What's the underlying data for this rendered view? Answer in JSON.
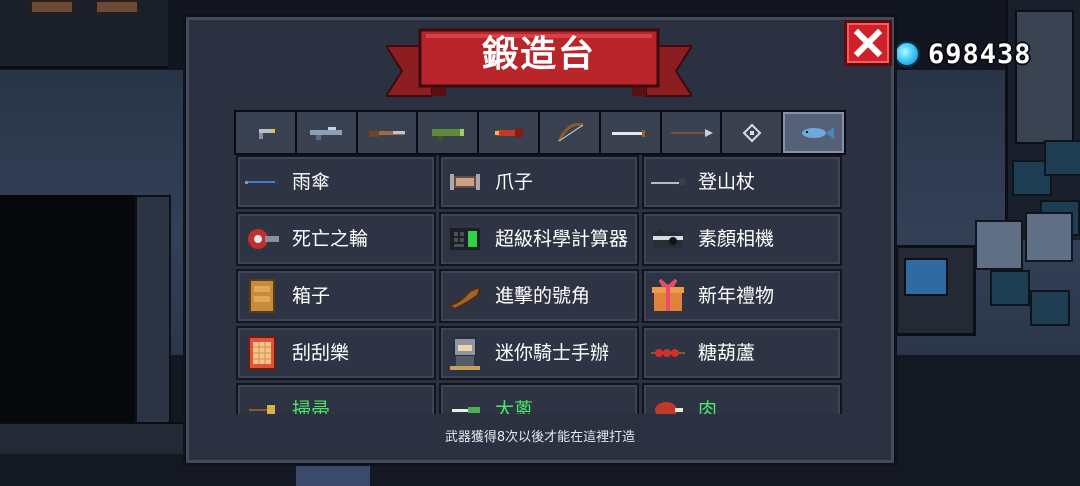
{
  "title": "鍛造台",
  "coins": "698438",
  "footer_hint": "武器獲得8次以後才能在這裡打造",
  "tabs": [
    {
      "icon": "pistol-icon"
    },
    {
      "icon": "rifle-icon"
    },
    {
      "icon": "shotgun-icon"
    },
    {
      "icon": "launcher-icon"
    },
    {
      "icon": "rocket-icon"
    },
    {
      "icon": "bow-icon"
    },
    {
      "icon": "sword-icon"
    },
    {
      "icon": "spear-icon"
    },
    {
      "icon": "staff-icon"
    },
    {
      "icon": "fish-icon"
    }
  ],
  "items": [
    {
      "label": "雨傘",
      "icon": "umbrella-icon",
      "color": "white"
    },
    {
      "label": "爪子",
      "icon": "claw-icon",
      "color": "white"
    },
    {
      "label": "登山杖",
      "icon": "hiking-pole-icon",
      "color": "white"
    },
    {
      "label": "死亡之輪",
      "icon": "death-wheel-icon",
      "color": "white"
    },
    {
      "label": "超級科學計算器",
      "icon": "calculator-icon",
      "color": "white"
    },
    {
      "label": "素顏相機",
      "icon": "camera-icon",
      "color": "white"
    },
    {
      "label": "箱子",
      "icon": "box-icon",
      "color": "white"
    },
    {
      "label": "進擊的號角",
      "icon": "horn-icon",
      "color": "white"
    },
    {
      "label": "新年禮物",
      "icon": "gift-icon",
      "color": "white"
    },
    {
      "label": "刮刮樂",
      "icon": "scratch-card-icon",
      "color": "white"
    },
    {
      "label": "迷你騎士手辦",
      "icon": "knight-figure-icon",
      "color": "white"
    },
    {
      "label": "糖葫蘆",
      "icon": "candied-haws-icon",
      "color": "white"
    },
    {
      "label": "掃帚",
      "icon": "broom-icon",
      "color": "green"
    },
    {
      "label": "大蔥",
      "icon": "leek-icon",
      "color": "green"
    },
    {
      "label": "肉",
      "icon": "meat-icon",
      "color": "green"
    }
  ]
}
